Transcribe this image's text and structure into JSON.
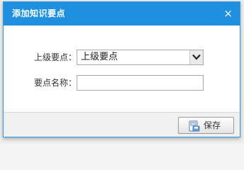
{
  "dialog": {
    "title": "添加知识要点",
    "close_glyph": "×"
  },
  "form": {
    "parent": {
      "label": "上级要点：",
      "selected": "上级要点"
    },
    "name": {
      "label": "要点名称：",
      "value": "",
      "placeholder": ""
    }
  },
  "footer": {
    "save_label": "保存"
  },
  "colors": {
    "titlebar": "#1f8fe0",
    "dialog_border": "#2f9be0",
    "footer": "#f0f0f0"
  },
  "icons": {
    "close": "close-icon",
    "dropdown": "chevron-down-icon",
    "save": "save-icon"
  }
}
